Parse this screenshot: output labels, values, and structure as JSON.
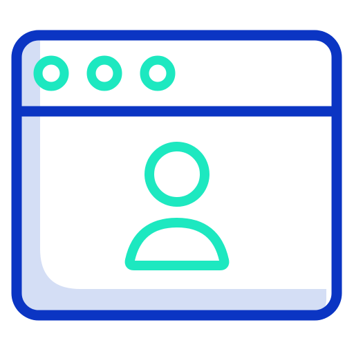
{
  "icon": {
    "name": "browser-user-profile-icon",
    "depicts": [
      "browser-window-icon",
      "window-control-dots",
      "user-avatar-icon"
    ]
  },
  "colors": {
    "frame_stroke": "#0b35c3",
    "accent_teal": "#1de8c0",
    "shadow_fill": "#d4def5",
    "background": "#ffffff"
  }
}
